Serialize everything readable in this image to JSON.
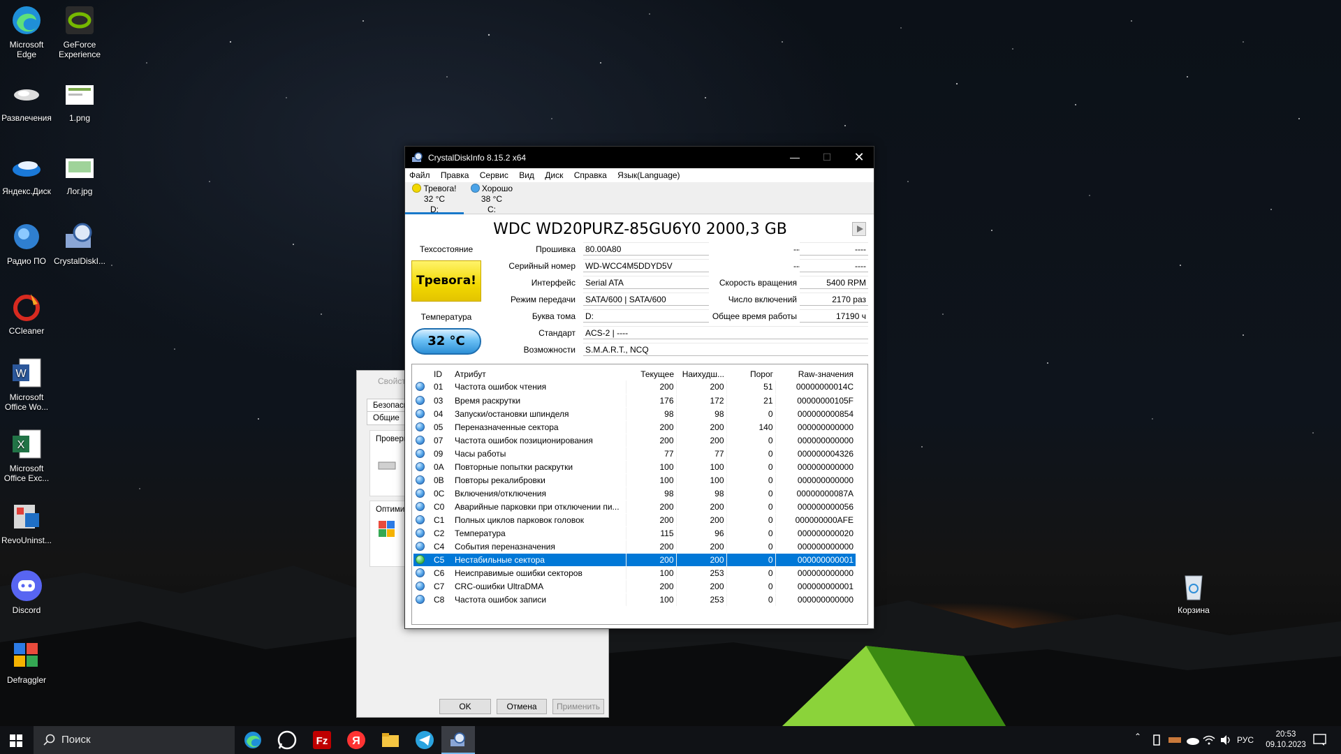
{
  "desktop": {
    "icons": [
      {
        "label": "Microsoft\nEdge",
        "l1": "Microsoft",
        "l2": "Edge"
      },
      {
        "l1": "GeForce",
        "l2": "Experience"
      },
      {
        "l1": "Развлечения",
        "l2": ""
      },
      {
        "l1": "1.png",
        "l2": ""
      },
      {
        "l1": "Яндекс.Диск",
        "l2": ""
      },
      {
        "l1": "Лог.jpg",
        "l2": ""
      },
      {
        "l1": "Радио ПО",
        "l2": ""
      },
      {
        "l1": "CrystalDiskI...",
        "l2": ""
      },
      {
        "l1": "CCleaner",
        "l2": ""
      },
      {
        "l1": "Microsoft",
        "l2": "Office Wo..."
      },
      {
        "l1": "Microsoft",
        "l2": "Office Exc..."
      },
      {
        "l1": "RevoUninst...",
        "l2": ""
      },
      {
        "l1": "Discord",
        "l2": ""
      },
      {
        "l1": "Defraggler",
        "l2": ""
      }
    ],
    "recycle_bin": "Корзина"
  },
  "props_dialog": {
    "title": "Свойст",
    "tab_security": "Безопасно",
    "tab_general": "Общие",
    "group_check": "Проверк",
    "group_optimize": "Оптими",
    "ok": "OK",
    "cancel": "Отмена",
    "apply": "Применить"
  },
  "cdi": {
    "title": "CrystalDiskInfo 8.15.2 x64",
    "menu": [
      "Файл",
      "Правка",
      "Сервис",
      "Вид",
      "Диск",
      "Справка",
      "Язык(Language)"
    ],
    "disks": [
      {
        "status": "Тревога!",
        "temp": "32 °C",
        "letter": "D:",
        "color": "#f2d800"
      },
      {
        "status": "Хорошо",
        "temp": "38 °C",
        "letter": "C:",
        "color": "#4aa3e8"
      }
    ],
    "model": "WDC WD20PURZ-85GU6Y0 2000,3 GB",
    "health_label": "Техсостояние",
    "health_value": "Тревога!",
    "temp_label": "Температура",
    "temp_value": "32 °C",
    "labels": {
      "firmware": "Прошивка",
      "serial": "Серийный номер",
      "interface": "Интерфейс",
      "transfer": "Режим передачи",
      "drive_letter": "Буква тома",
      "standard": "Стандарт",
      "features": "Возможности",
      "blank1": "----",
      "blank2": "----",
      "rotation": "Скорость вращения",
      "power_count": "Число включений",
      "power_hours": "Общее время работы"
    },
    "values": {
      "firmware": "80.00A80",
      "serial": "WD-WCC4M5DDYD5V",
      "interface": "Serial ATA",
      "transfer": "SATA/600 | SATA/600",
      "drive_letter": "D:",
      "standard": "ACS-2 | ----",
      "features": "S.M.A.R.T., NCQ",
      "blank1": "----",
      "blank2": "----",
      "rotation": "5400 RPM",
      "power_count": "2170 раз",
      "power_hours": "17190 ч"
    },
    "smart_headers": [
      "ID",
      "Атрибут",
      "Текущее",
      "Наихудш...",
      "Порог",
      "Raw-значения"
    ],
    "smart_rows": [
      {
        "id": "01",
        "name": "Частота ошибок чтения",
        "cur": "200",
        "worst": "200",
        "thr": "51",
        "raw": "00000000014C"
      },
      {
        "id": "03",
        "name": "Время раскрутки",
        "cur": "176",
        "worst": "172",
        "thr": "21",
        "raw": "00000000105F"
      },
      {
        "id": "04",
        "name": "Запуски/остановки шпинделя",
        "cur": "98",
        "worst": "98",
        "thr": "0",
        "raw": "000000000854"
      },
      {
        "id": "05",
        "name": "Переназначенные сектора",
        "cur": "200",
        "worst": "200",
        "thr": "140",
        "raw": "000000000000"
      },
      {
        "id": "07",
        "name": "Частота ошибок позиционирования",
        "cur": "200",
        "worst": "200",
        "thr": "0",
        "raw": "000000000000"
      },
      {
        "id": "09",
        "name": "Часы работы",
        "cur": "77",
        "worst": "77",
        "thr": "0",
        "raw": "000000004326"
      },
      {
        "id": "0A",
        "name": "Повторные попытки раскрутки",
        "cur": "100",
        "worst": "100",
        "thr": "0",
        "raw": "000000000000"
      },
      {
        "id": "0B",
        "name": "Повторы рекалибровки",
        "cur": "100",
        "worst": "100",
        "thr": "0",
        "raw": "000000000000"
      },
      {
        "id": "0C",
        "name": "Включения/отключения",
        "cur": "98",
        "worst": "98",
        "thr": "0",
        "raw": "00000000087A"
      },
      {
        "id": "C0",
        "name": "Аварийные парковки при отключении пи...",
        "cur": "200",
        "worst": "200",
        "thr": "0",
        "raw": "000000000056"
      },
      {
        "id": "C1",
        "name": "Полных циклов парковок головок",
        "cur": "200",
        "worst": "200",
        "thr": "0",
        "raw": "000000000AFE"
      },
      {
        "id": "C2",
        "name": "Температура",
        "cur": "115",
        "worst": "96",
        "thr": "0",
        "raw": "000000000020"
      },
      {
        "id": "C4",
        "name": "События переназначения",
        "cur": "200",
        "worst": "200",
        "thr": "0",
        "raw": "000000000000"
      },
      {
        "id": "C5",
        "name": "Нестабильные сектора",
        "cur": "200",
        "worst": "200",
        "thr": "0",
        "raw": "000000000001",
        "selected": true
      },
      {
        "id": "C6",
        "name": "Неисправимые ошибки секторов",
        "cur": "100",
        "worst": "253",
        "thr": "0",
        "raw": "000000000000"
      },
      {
        "id": "C7",
        "name": "CRC-ошибки UltraDMA",
        "cur": "200",
        "worst": "200",
        "thr": "0",
        "raw": "000000000001"
      },
      {
        "id": "C8",
        "name": "Частота ошибок записи",
        "cur": "100",
        "worst": "253",
        "thr": "0",
        "raw": "000000000000"
      }
    ]
  },
  "taskbar": {
    "search_placeholder": "Поиск",
    "lang": "РУС",
    "time": "20:53",
    "date": "09.10.2023"
  }
}
